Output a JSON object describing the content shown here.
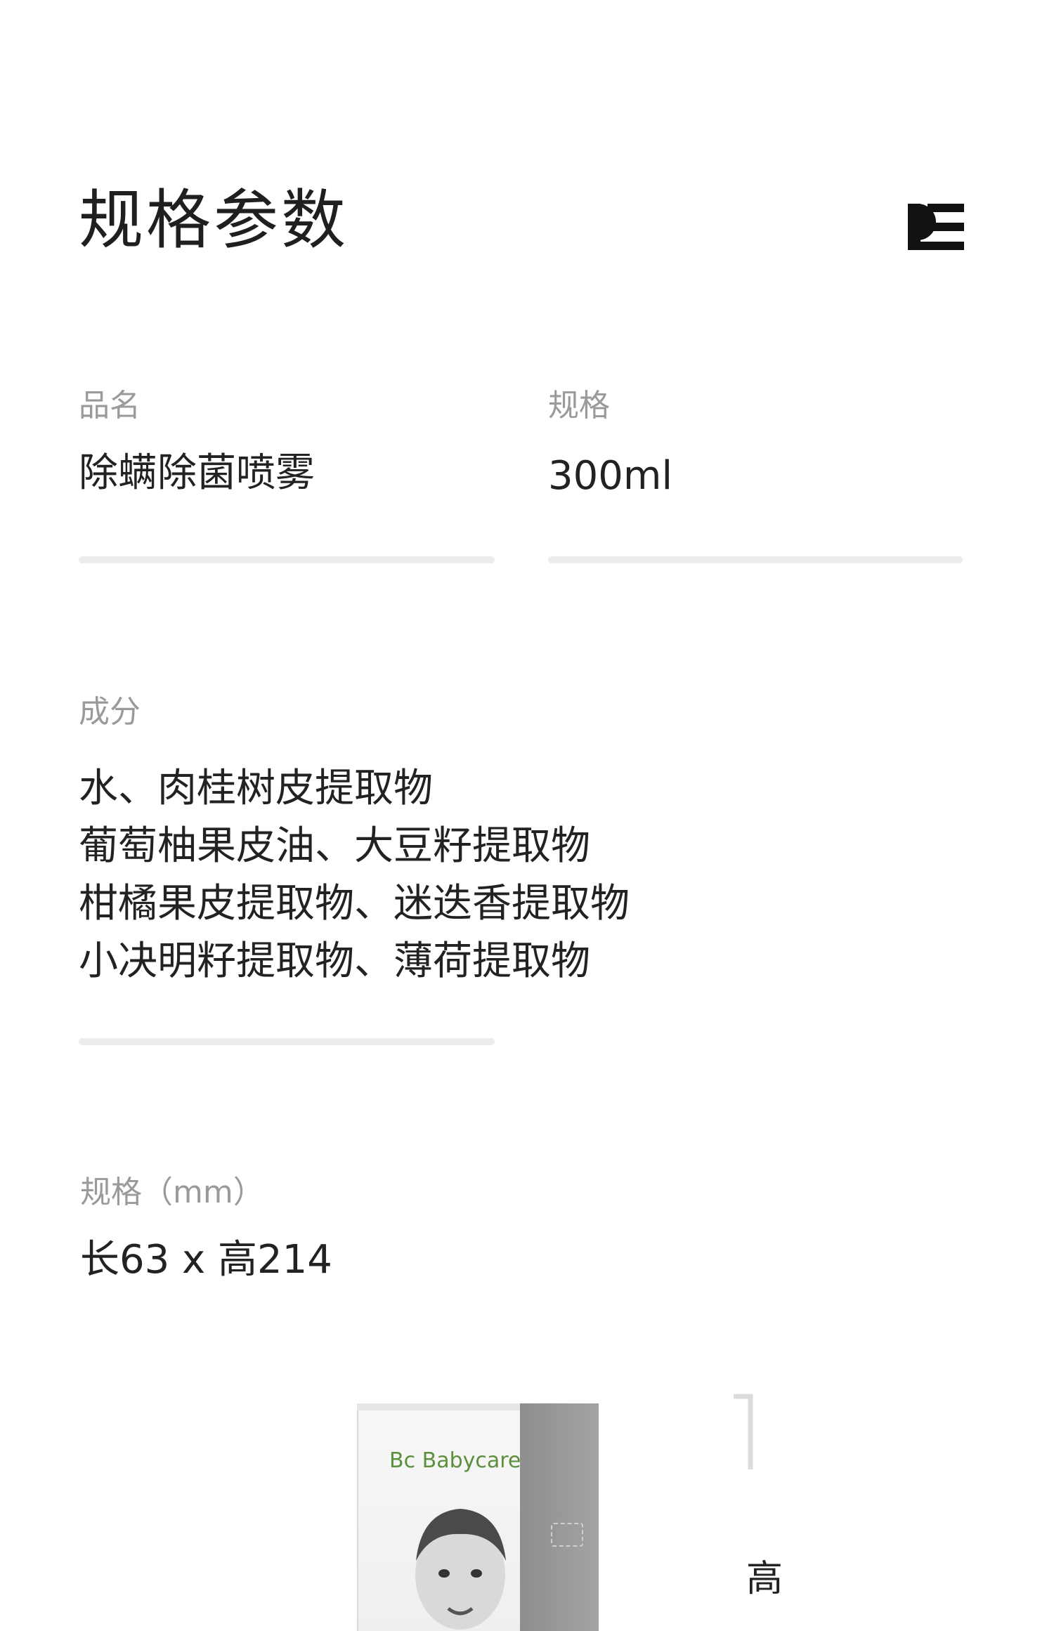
{
  "header": {
    "title": "规格参数"
  },
  "specs": {
    "name_label": "品名",
    "name_value": "除螨除菌喷雾",
    "size_label": "规格",
    "size_value": "300ml"
  },
  "ingredients": {
    "label": "成分",
    "lines": [
      "水、肉桂树皮提取物",
      "葡萄柚果皮油、大豆籽提取物",
      "柑橘果皮提取物、迷迭香提取物",
      "小决明籽提取物、薄荷提取物"
    ]
  },
  "dimensions": {
    "label": "规格（mm）",
    "value": "长63 x 高214",
    "height_marker": "高"
  },
  "product": {
    "brand": "Bc Babycare"
  },
  "colors": {
    "divider": "#ececec",
    "label_gray": "#9a9a9a",
    "brand_green": "#5c8f3c"
  }
}
